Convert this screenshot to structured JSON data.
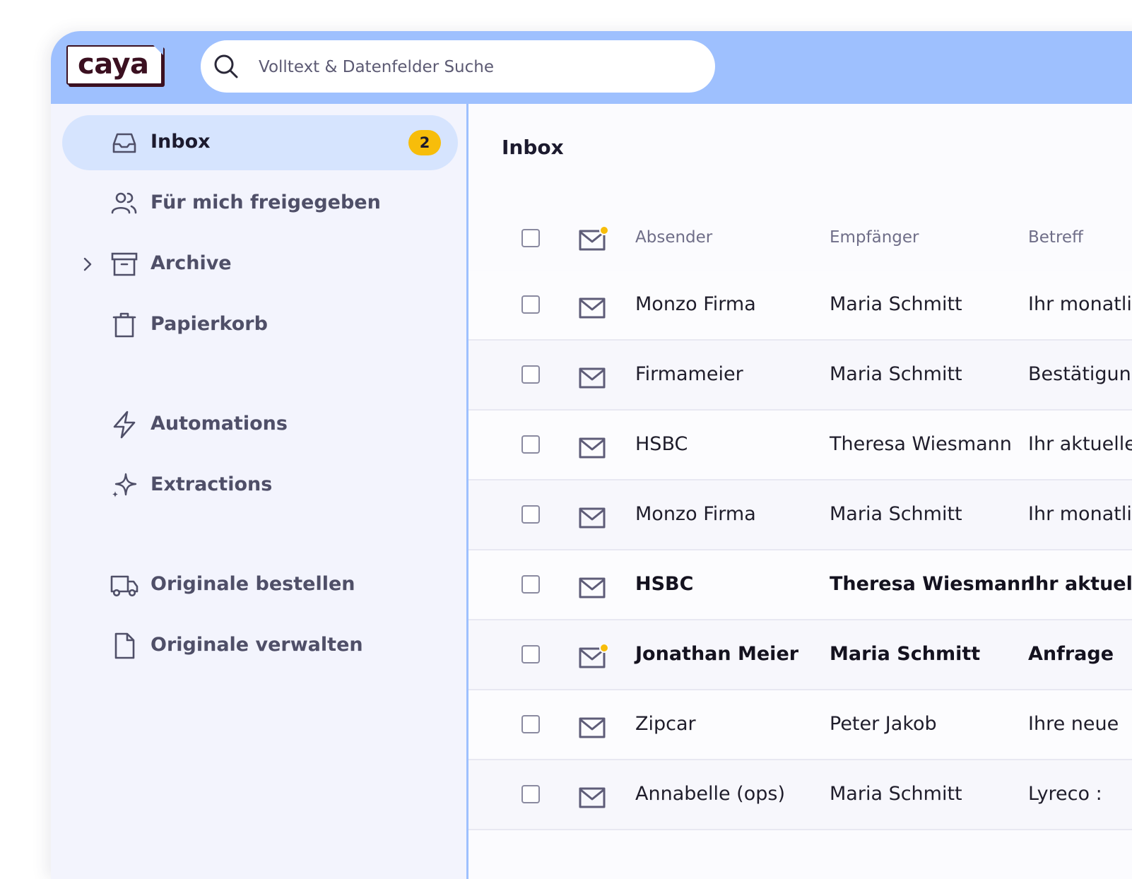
{
  "app": {
    "logo_text": "caya"
  },
  "search": {
    "placeholder": "Volltext & Datenfelder Suche"
  },
  "sidebar": {
    "items": [
      {
        "label": "Inbox",
        "badge": "2",
        "icon": "inbox-icon",
        "active": true
      },
      {
        "label": "Für mich freigegeben",
        "icon": "users-icon"
      },
      {
        "label": "Archive",
        "icon": "archive-icon",
        "expandable": true
      },
      {
        "label": "Papierkorb",
        "icon": "trash-icon"
      },
      {
        "label": "Automations",
        "icon": "lightning-icon"
      },
      {
        "label": "Extractions",
        "icon": "sparkles-icon"
      },
      {
        "label": "Originale bestellen",
        "icon": "truck-icon"
      },
      {
        "label": "Originale verwalten",
        "icon": "document-icon"
      }
    ]
  },
  "main": {
    "title": "Inbox",
    "columns": {
      "sender": "Absender",
      "recipient": "Empfänger",
      "subject": "Betreff"
    },
    "rows": [
      {
        "sender": "Monzo Firma",
        "recipient": "Maria Schmitt",
        "subject": "Ihr monatlicher",
        "unread": false
      },
      {
        "sender": "Firmameier",
        "recipient": "Maria Schmitt",
        "subject": "Bestätigung",
        "unread": false
      },
      {
        "sender": "HSBC",
        "recipient": "Theresa Wiesmann",
        "subject": "Ihr aktueller",
        "unread": false
      },
      {
        "sender": "Monzo Firma",
        "recipient": "Maria Schmitt",
        "subject": "Ihr monatlicher",
        "unread": false
      },
      {
        "sender": "HSBC",
        "recipient": "Theresa Wiesmann",
        "subject": "Ihr aktueller",
        "unread": true
      },
      {
        "sender": "Jonathan Meier",
        "recipient": "Maria Schmitt",
        "subject": "Anfrage",
        "unread": true,
        "new_dot": true
      },
      {
        "sender": "Zipcar",
        "recipient": "Peter Jakob",
        "subject": "Ihre neue",
        "unread": false
      },
      {
        "sender": "Annabelle (ops)",
        "recipient": "Maria Schmitt",
        "subject": "Lyreco : ",
        "unread": false
      }
    ]
  },
  "colors": {
    "topbar": "#9ec0fe",
    "active_nav": "#d6e4fe",
    "badge": "#f7bd0a",
    "logo": "#3b1020"
  }
}
